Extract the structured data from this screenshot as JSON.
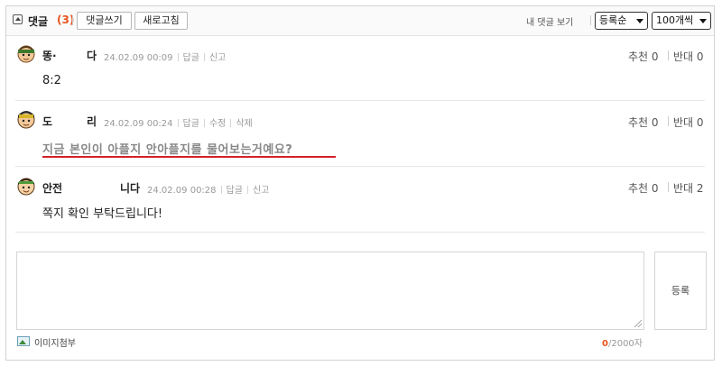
{
  "header": {
    "title": "댓글",
    "count": "(3)",
    "write_button": "댓글쓰기",
    "refresh_button": "새로고침",
    "view_mine": "내 댓글 보기",
    "sort_select": "등록순",
    "page_size_select": "100개씩"
  },
  "comments": [
    {
      "author_a": "똥·",
      "author_b": "다",
      "time": "24.02.09 00:09",
      "actions": [
        "답글",
        "신고"
      ],
      "body": "8:2",
      "recommend": "추천 0",
      "oppose": "반대 0"
    },
    {
      "author_a": "도",
      "author_b": "리",
      "time": "24.02.09 00:24",
      "actions": [
        "답글",
        "수정",
        "삭제"
      ],
      "body": "지금 본인이 아플지 안아플지를 물어보는거예요?",
      "recommend": "추천 0",
      "oppose": "반대 0"
    },
    {
      "author_a": "안전",
      "author_b": "니다",
      "time": "24.02.09 00:28",
      "actions": [
        "답글",
        "신고"
      ],
      "body": "쪽지 확인 부탁드립니다!",
      "recommend": "추천 0",
      "oppose": "반대 2"
    }
  ],
  "editor": {
    "submit_label": "등록",
    "attach_label": "이미지첨부",
    "char_current": "0",
    "char_limit": "/2000자"
  },
  "colors": {
    "accent": "#e8541e",
    "underline": "#d4202a"
  }
}
